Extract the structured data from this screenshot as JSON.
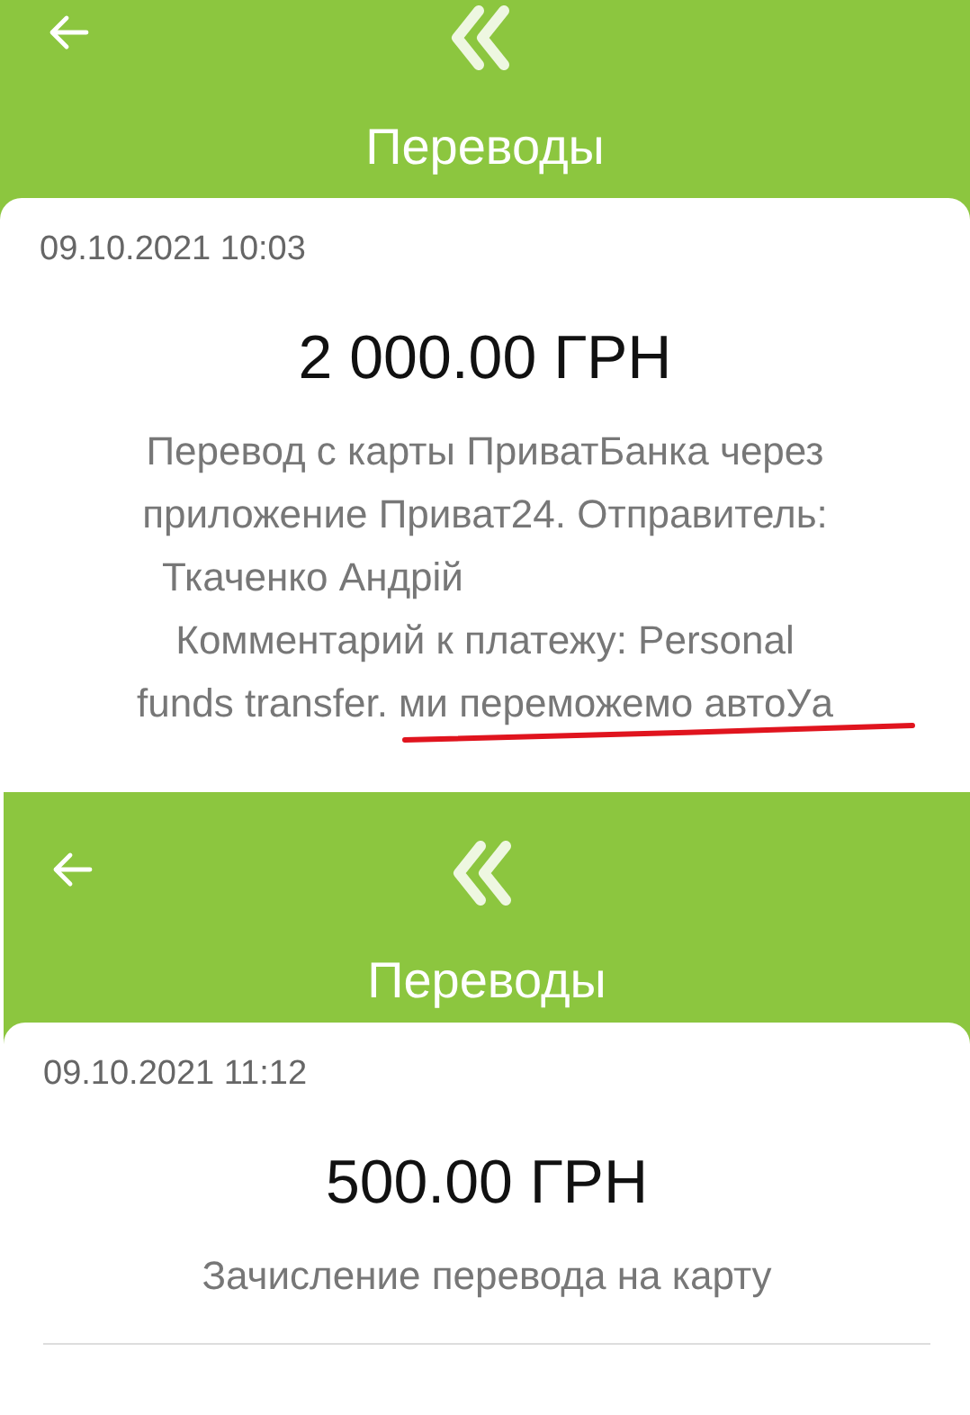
{
  "panels": [
    {
      "title": "Переводы",
      "date": "09.10.2021 10:03",
      "amount": "2 000.00 ГРН",
      "description_lines": [
        "Перевод с карты ПриватБанка через",
        "приложение Приват24. Отправитель:",
        "Ткаченко Андрій",
        "Комментарий к платежу: Personal",
        "funds transfer. ми переможемо автоУа"
      ],
      "underlined": true,
      "divider": false
    },
    {
      "title": "Переводы",
      "date": "09.10.2021 11:12",
      "amount": "500.00 ГРН",
      "description_lines": [
        "Зачисление перевода на карту"
      ],
      "underlined": false,
      "divider": true
    }
  ]
}
